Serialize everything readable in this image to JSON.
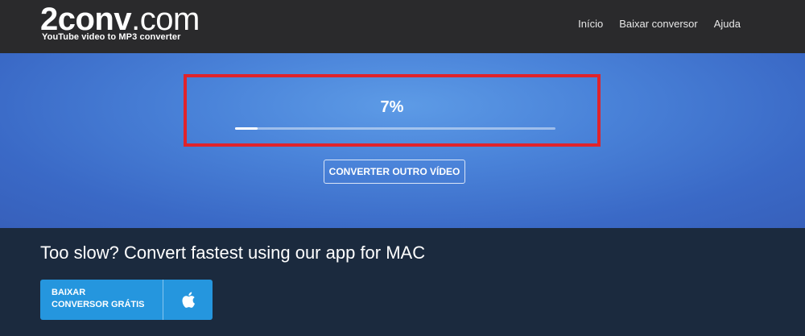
{
  "header": {
    "logo_bold": "2conv",
    "logo_rest": ".com",
    "tagline": "YouTube video to MP3 converter",
    "nav": [
      {
        "label": "Início"
      },
      {
        "label": "Baixar conversor"
      },
      {
        "label": "Ajuda"
      }
    ]
  },
  "progress": {
    "percent_label": "7%",
    "value": 0.07
  },
  "convert_button_label": "CONVERTER OUTRO VÍDEO",
  "promo": {
    "title": "Too slow? Convert fastest using our app for MAC",
    "download_line1": "BAIXAR",
    "download_line2": "CONVERSOR GRÁTIS",
    "download_icon": "apple-icon"
  },
  "colors": {
    "topbar": "#2a2a2c",
    "hero_blue": "#4a83d9",
    "highlight_red": "#e0232b",
    "promo_bg": "#1b2a3e",
    "download_button": "#2596de"
  }
}
